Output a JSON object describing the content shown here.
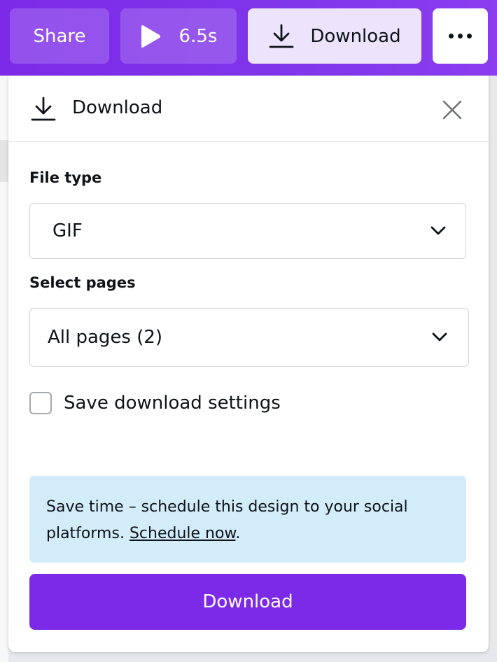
{
  "toolbar": {
    "share_label": "Share",
    "play_duration": "6.5s",
    "download_label": "Download",
    "more_icon": "more-horizontal-icon"
  },
  "panel": {
    "title": "Download",
    "icons": {
      "header": "download-icon",
      "close": "close-icon",
      "select": "chevron-down-icon"
    },
    "file_type": {
      "label": "File type",
      "selected": "GIF"
    },
    "pages": {
      "label": "Select pages",
      "selected": "All pages (2)"
    },
    "save_settings": {
      "label": "Save download settings",
      "checked": false
    },
    "info": {
      "text_before": "Save time – schedule this design to your social platforms. ",
      "link": "Schedule now",
      "text_after": "."
    },
    "download_button": "Download"
  },
  "colors": {
    "brand_purple": "#7d2ae8",
    "download_tab_bg": "#ede3fc",
    "info_bg": "#d3ecfa"
  }
}
